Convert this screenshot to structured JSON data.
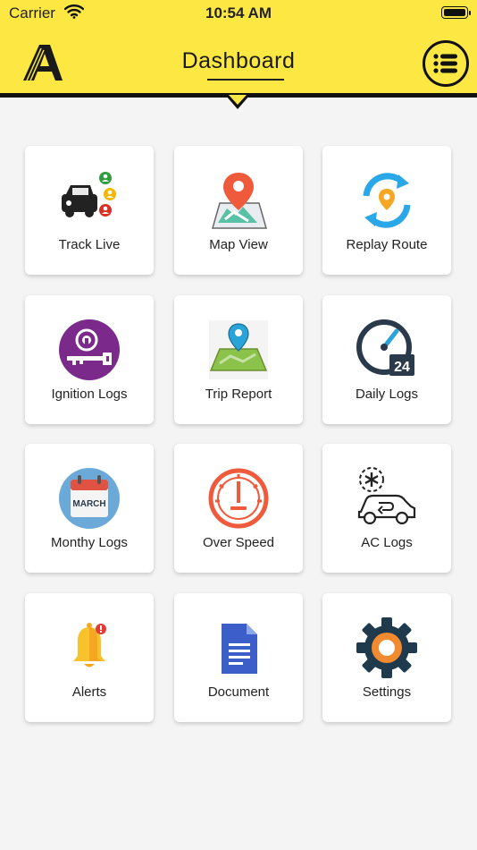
{
  "status_bar": {
    "carrier": "Carrier",
    "time": "10:54 AM"
  },
  "header": {
    "title": "Dashboard",
    "accent_color": "#fde843"
  },
  "tiles": [
    {
      "label": "Track Live",
      "icon": "car-tracking-icon"
    },
    {
      "label": "Map View",
      "icon": "map-pin-icon"
    },
    {
      "label": "Replay Route",
      "icon": "replay-route-icon"
    },
    {
      "label": "Ignition Logs",
      "icon": "ignition-key-icon"
    },
    {
      "label": "Trip Report",
      "icon": "trip-map-icon"
    },
    {
      "label": "Daily Logs",
      "icon": "daily-24-gauge-icon"
    },
    {
      "label": "Monthy Logs",
      "icon": "calendar-icon",
      "icon_text": "MARCH"
    },
    {
      "label": "Over Speed",
      "icon": "speedometer-icon"
    },
    {
      "label": "AC Logs",
      "icon": "ac-car-icon"
    },
    {
      "label": "Alerts",
      "icon": "bell-icon"
    },
    {
      "label": "Document",
      "icon": "document-icon"
    },
    {
      "label": "Settings",
      "icon": "gear-icon"
    }
  ]
}
